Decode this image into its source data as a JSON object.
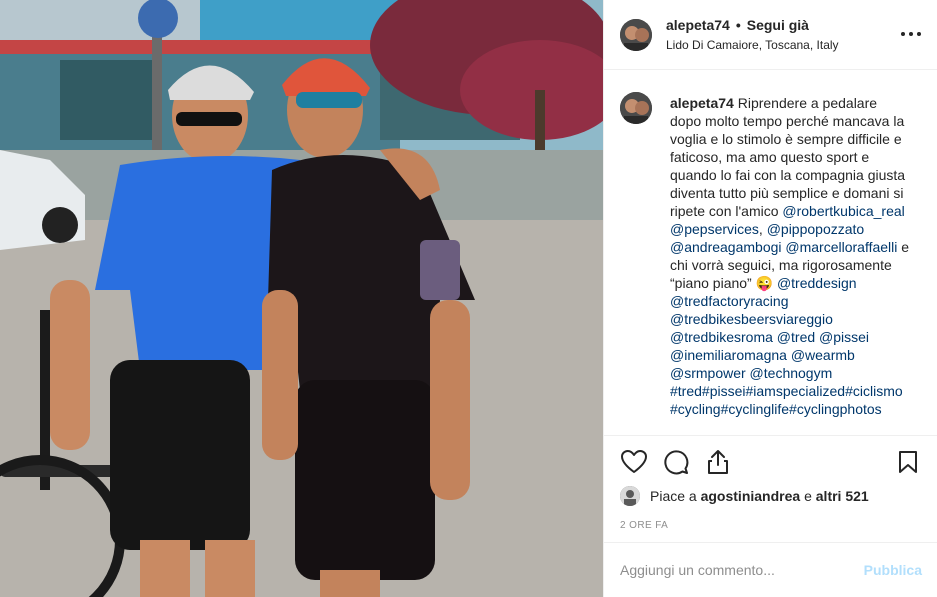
{
  "post": {
    "username": "alepeta74",
    "separator": "•",
    "follow_label": "Segui già",
    "location": "Lido Di Camaiore, Toscana, Italy",
    "more_icon": "more-options-icon"
  },
  "caption": {
    "username": "alepeta74",
    "text": "Riprendere a pedalare dopo molto tempo perché mancava la voglia e lo stimolo è sempre difficile e faticoso, ma amo questo sport e quando lo fai con la compagnia giusta diventa tutto più semplice e domani si ripete con l'amico",
    "mentions_1": "@robertkubica_real @pepservices",
    "sep_1": ", ",
    "mentions_2": "@pippopozzato @andreagambogi @marcelloraffaelli",
    "middle_text": "e chi vorrà seguici, ma rigorosamente “piano piano”",
    "emoji": "😜",
    "mentions_3": "@treddesign @tredfactoryracing @tredbikesbeersviareggio @tredbikesroma @tred @pissei @inemiliaromagna @wearmb @srmpower @technogym #tred#pissei#iamspecialized#ciclismo#cycling#cyclinglife#cyclingphotos"
  },
  "actions": {
    "like_icon": "heart-icon",
    "comment_icon": "comment-icon",
    "share_icon": "share-icon",
    "save_icon": "bookmark-icon"
  },
  "likes": {
    "prefix": "Piace a",
    "user": "agostiniandrea",
    "conj": "e",
    "others": "altri 521"
  },
  "timestamp": "2 ORE FA",
  "comment_box": {
    "placeholder": "Aggiungi un commento...",
    "publish_label": "Pubblica"
  },
  "colors": {
    "link": "#00376b",
    "publish_disabled": "#b2dffc",
    "muted": "#8e8e8e",
    "border": "#efefef"
  }
}
